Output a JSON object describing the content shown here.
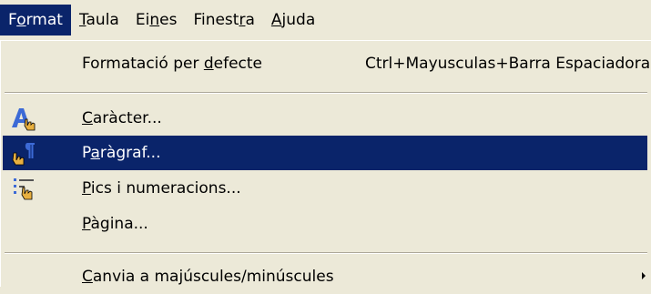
{
  "menubar": {
    "items": [
      {
        "pre": "F",
        "acc": "o",
        "post": "rmat"
      },
      {
        "pre": "",
        "acc": "T",
        "post": "aula"
      },
      {
        "pre": "Ei",
        "acc": "n",
        "post": "es"
      },
      {
        "pre": "Finest",
        "acc": "r",
        "post": "a"
      },
      {
        "pre": "",
        "acc": "A",
        "post": "juda"
      }
    ]
  },
  "format_menu": {
    "default_format": {
      "pre": "Formatació per ",
      "acc": "d",
      "post": "efecte",
      "shortcut": "Ctrl+Mayusculas+Barra Espaciadora"
    },
    "character": {
      "pre": "",
      "acc": "C",
      "post": "aràcter..."
    },
    "paragraph": {
      "pre": "P",
      "acc": "a",
      "post": "ràgraf..."
    },
    "bullets": {
      "pre": "",
      "acc": "P",
      "post": "ics i numeracions..."
    },
    "page": {
      "pre": "",
      "acc": "P",
      "post": "àgina..."
    },
    "change_case": {
      "pre": "",
      "acc": "C",
      "post": "anvia a majúscules/minúscules"
    }
  },
  "colors": {
    "menu_bg": "#ece9d8",
    "highlight": "#0a246a",
    "icon_blue": "#3c6ad6",
    "icon_yellow": "#e8b040"
  }
}
